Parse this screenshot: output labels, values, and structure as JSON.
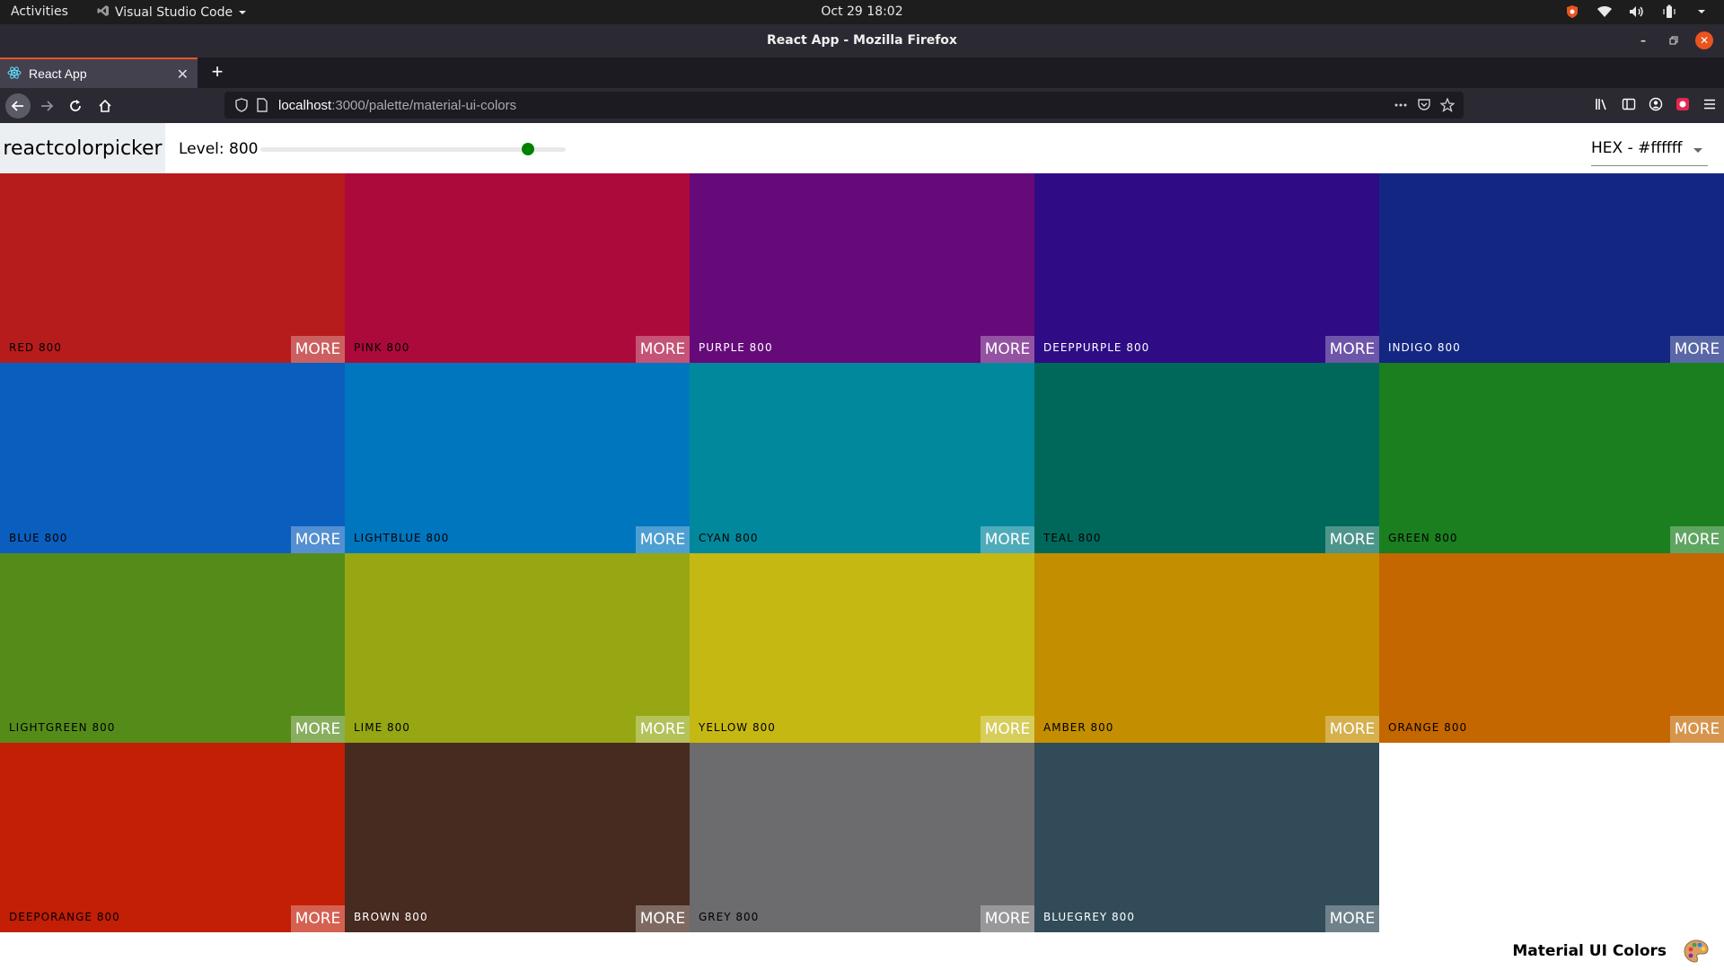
{
  "system": {
    "activities": "Activities",
    "app_name": "Visual Studio Code",
    "clock": "Oct 29  18:02"
  },
  "window": {
    "title": "React App - Mozilla Firefox"
  },
  "browser": {
    "tab_title": "React App",
    "url_host": "localhost",
    "url_path": ":3000/palette/material-ui-colors"
  },
  "app": {
    "logo": "reactcolorpicker",
    "level_label": "Level: 800",
    "level": 800,
    "level_min": 100,
    "level_max": 900,
    "format": "HEX - #ffffff",
    "slider_color": "#008000"
  },
  "palette": {
    "name": "Material UI Colors",
    "emoji": "palette",
    "more_label": "MORE",
    "colors": [
      {
        "name": "RED 800",
        "hex": "#b71c1c",
        "text": "#000000"
      },
      {
        "name": "PINK 800",
        "hex": "#ad0a3c",
        "text": "#000000"
      },
      {
        "name": "PURPLE 800",
        "hex": "#660a7a",
        "text": "#ffffff"
      },
      {
        "name": "DEEPPURPLE 800",
        "hex": "#2f0c85",
        "text": "#ffffff"
      },
      {
        "name": "INDIGO 800",
        "hex": "#132682",
        "text": "#ffffff"
      },
      {
        "name": "BLUE 800",
        "hex": "#0a5fbe",
        "text": "#000000"
      },
      {
        "name": "LIGHTBLUE 800",
        "hex": "#0076bf",
        "text": "#000000"
      },
      {
        "name": "CYAN 800",
        "hex": "#02889c",
        "text": "#000000"
      },
      {
        "name": "TEAL 800",
        "hex": "#00685a",
        "text": "#000000"
      },
      {
        "name": "GREEN 800",
        "hex": "#1b7f1f",
        "text": "#000000"
      },
      {
        "name": "LIGHTGREEN 800",
        "hex": "#558c19",
        "text": "#000000"
      },
      {
        "name": "LIME 800",
        "hex": "#96a713",
        "text": "#000000"
      },
      {
        "name": "YELLOW 800",
        "hex": "#c6b813",
        "text": "#000000"
      },
      {
        "name": "AMBER 800",
        "hex": "#c38e00",
        "text": "#000000"
      },
      {
        "name": "ORANGE 800",
        "hex": "#c56700",
        "text": "#000000"
      },
      {
        "name": "DEEPORANGE 800",
        "hex": "#c31e06",
        "text": "#000000"
      },
      {
        "name": "BROWN 800",
        "hex": "#472a20",
        "text": "#ffffff"
      },
      {
        "name": "GREY 800",
        "hex": "#6c6b6d",
        "text": "#000000"
      },
      {
        "name": "BLUEGREY 800",
        "hex": "#314b59",
        "text": "#ffffff"
      }
    ]
  }
}
